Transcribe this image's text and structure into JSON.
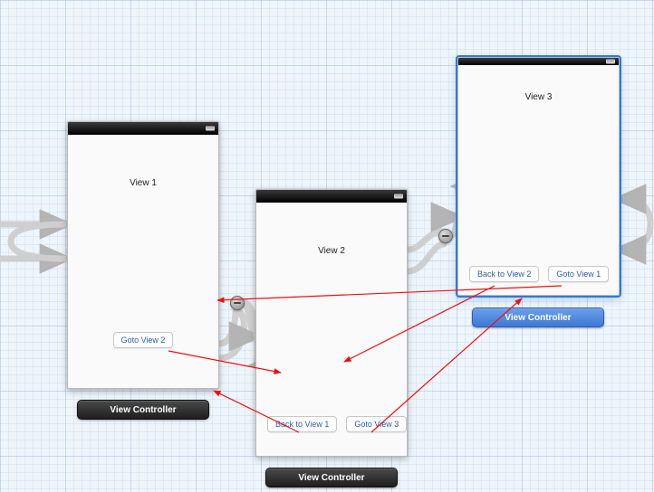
{
  "scenes": {
    "vc1": {
      "title": "View 1",
      "label": "View Controller",
      "selected": false,
      "buttons": {
        "goto2": "Goto View 2"
      }
    },
    "vc2": {
      "title": "View 2",
      "label": "View Controller",
      "selected": false,
      "buttons": {
        "back1": "Back to View 1",
        "goto3": "Goto View 3"
      }
    },
    "vc3": {
      "title": "View 3",
      "label": "View Controller",
      "selected": true,
      "buttons": {
        "back2": "Back to View 2",
        "goto1": "Goto View 1"
      }
    }
  }
}
